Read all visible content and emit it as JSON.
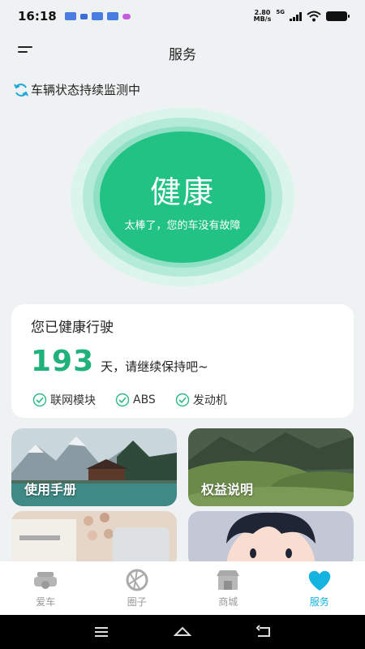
{
  "status_bar": {
    "time": "16:18",
    "net_speed_value": "2.80",
    "net_speed_unit": "MB/s",
    "signal_label": "5G"
  },
  "header": {
    "title": "服务",
    "menu_icon": "menu-icon"
  },
  "monitor": {
    "text": "车辆状态持续监测中",
    "icon": "refresh-icon",
    "color": "#21a7d8"
  },
  "health": {
    "status": "健康",
    "message": "太棒了，您的车没有故障",
    "color": "#21c283"
  },
  "card": {
    "title": "您已健康行驶",
    "days": "193",
    "days_suffix": "天，请继续保持吧~",
    "checks": [
      {
        "label": "联网模块"
      },
      {
        "label": "ABS"
      },
      {
        "label": "发动机"
      }
    ]
  },
  "tiles": [
    {
      "label": "使用手册"
    },
    {
      "label": "权益说明"
    },
    {
      "label": ""
    },
    {
      "label": ""
    }
  ],
  "tabs": [
    {
      "label": "爱车",
      "icon": "car-icon"
    },
    {
      "label": "圈子",
      "icon": "aperture-icon"
    },
    {
      "label": "商城",
      "icon": "store-icon"
    },
    {
      "label": "服务",
      "icon": "heart-icon",
      "active": true
    }
  ],
  "accent_color": "#14b3e0"
}
